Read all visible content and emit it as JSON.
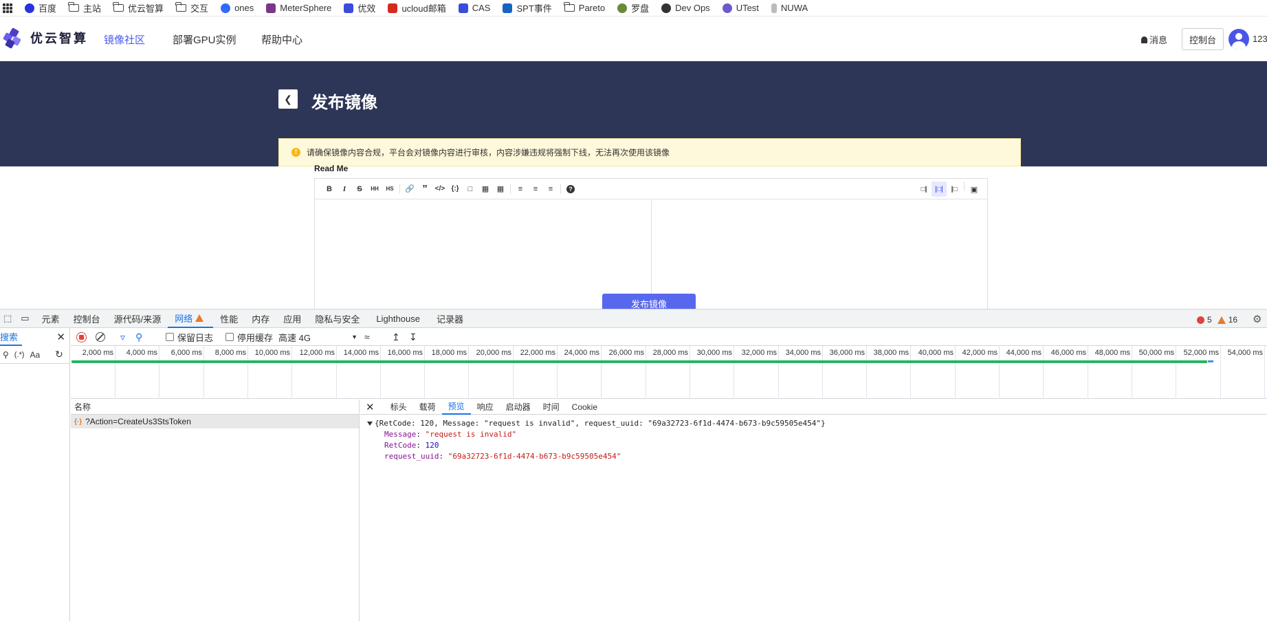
{
  "bookmarks": [
    {
      "label": "百度",
      "icon": "baidu-icon",
      "color": "#2932e1"
    },
    {
      "label": "主站",
      "icon": "folder-icon"
    },
    {
      "label": "优云智算",
      "icon": "folder-icon"
    },
    {
      "label": "交互",
      "icon": "folder-icon"
    },
    {
      "label": "ones",
      "icon": "ones-icon",
      "color": "#2f6bff"
    },
    {
      "label": "MeterSphere",
      "icon": "metersphere-icon",
      "color": "#783887"
    },
    {
      "label": "优效",
      "icon": "u-icon",
      "color": "#3b4bdc"
    },
    {
      "label": "ucloud邮箱",
      "icon": "mail-icon",
      "color": "#d52b1e"
    },
    {
      "label": "CAS",
      "icon": "u-icon",
      "color": "#3b4bdc"
    },
    {
      "label": "SPT事件",
      "icon": "spt-icon",
      "color": "#1565c0"
    },
    {
      "label": "Pareto",
      "icon": "folder-icon"
    },
    {
      "label": "罗盘",
      "icon": "compass-icon",
      "color": "#6a8a3a"
    },
    {
      "label": "Dev Ops",
      "icon": "devops-icon",
      "color": "#333333"
    },
    {
      "label": "UTest",
      "icon": "utest-icon",
      "color": "#6a5acd"
    },
    {
      "label": "NUWA",
      "icon": "nuwa-icon",
      "color": "#999999"
    }
  ],
  "header": {
    "logo_text": "优云智算",
    "nav": [
      "镜像社区",
      "部署GPU实例",
      "帮助中心"
    ],
    "messages": "消息",
    "console": "控制台",
    "user": "123"
  },
  "banner": {
    "title": "发布镜像"
  },
  "card": {
    "notice": "请确保镜像内容合规，平台会对镜像内容进行审核，内容涉嫌违规将强制下线，无法再次使用该镜像",
    "readme_label": "Read Me",
    "publish_button": "发布镜像"
  },
  "devtools": {
    "tabs": [
      "元素",
      "控制台",
      "源代码/来源",
      "网络",
      "性能",
      "内存",
      "应用",
      "隐私与安全",
      "Lighthouse",
      "记录器"
    ],
    "errors": "5",
    "warnings": "16",
    "search_tab": "搜索",
    "search_opts": [
      "(.*)",
      "Aa"
    ],
    "preserve_log": "保留日志",
    "disable_cache": "停用缓存",
    "throttle": "高速 4G",
    "timeline_ticks": [
      "2,000 ms",
      "4,000 ms",
      "6,000 ms",
      "8,000 ms",
      "10,000 ms",
      "12,000 ms",
      "14,000 ms",
      "16,000 ms",
      "18,000 ms",
      "20,000 ms",
      "22,000 ms",
      "24,000 ms",
      "26,000 ms",
      "28,000 ms",
      "30,000 ms",
      "32,000 ms",
      "34,000 ms",
      "36,000 ms",
      "38,000 ms",
      "40,000 ms",
      "42,000 ms",
      "44,000 ms",
      "46,000 ms",
      "48,000 ms",
      "50,000 ms",
      "52,000 ms",
      "54,000 ms"
    ],
    "name_header": "名称",
    "request_name": "?Action=CreateUs3StsToken",
    "detail_tabs": [
      "标头",
      "载荷",
      "预览",
      "响应",
      "启动器",
      "时间",
      "Cookie"
    ],
    "preview": {
      "summary": "{RetCode: 120, Message: \"request is invalid\", request_uuid: \"69a32723-6f1d-4474-b673-b9c59505e454\"}",
      "message_key": "Message",
      "message_val": "\"request is invalid\"",
      "retcode_key": "RetCode",
      "retcode_val": "120",
      "uuid_key": "request_uuid",
      "uuid_val": "\"69a32723-6f1d-4474-b673-b9c59505e454\""
    }
  }
}
